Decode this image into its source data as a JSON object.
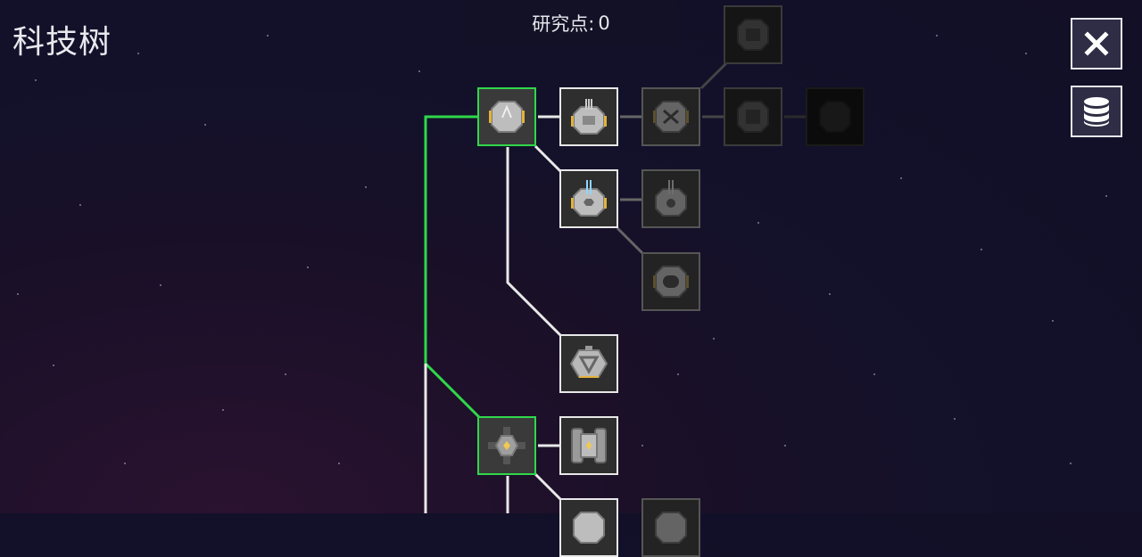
{
  "page": {
    "title": "科技树"
  },
  "research": {
    "label": "研究点:",
    "value": "0"
  },
  "buttons": {
    "close_icon": "close-icon",
    "database_icon": "database-icon"
  },
  "colors": {
    "researched": "#2fd84a",
    "available": "#e8e8e8",
    "locked": "#555555",
    "accent": "#e3b23c"
  },
  "nodes": [
    {
      "id": "hull-basic",
      "state": "researched",
      "icon": "turret-hull-icon"
    },
    {
      "id": "gun-1",
      "state": "available",
      "icon": "triple-barrel-turret-icon"
    },
    {
      "id": "gun-2",
      "state": "locked",
      "icon": "double-hull-icon"
    },
    {
      "id": "gun-3",
      "state": "hidden",
      "icon": "hull-icon"
    },
    {
      "id": "gun-4",
      "state": "hidden",
      "icon": "cannon-hull-icon"
    },
    {
      "id": "gun-5",
      "state": "dark",
      "icon": "hull-icon"
    },
    {
      "id": "laser-1",
      "state": "available",
      "icon": "laser-turret-icon"
    },
    {
      "id": "laser-2",
      "state": "locked",
      "icon": "laser-turret-icon"
    },
    {
      "id": "laser-3",
      "state": "locked",
      "icon": "capsule-hull-icon"
    },
    {
      "id": "shield-1",
      "state": "available",
      "icon": "triangle-module-icon"
    },
    {
      "id": "core-1",
      "state": "researched",
      "icon": "core-cross-icon"
    },
    {
      "id": "engine-1",
      "state": "available",
      "icon": "engine-block-icon"
    },
    {
      "id": "core-2",
      "state": "available",
      "icon": "hull-icon"
    },
    {
      "id": "core-3",
      "state": "locked",
      "icon": "hull-icon"
    }
  ]
}
